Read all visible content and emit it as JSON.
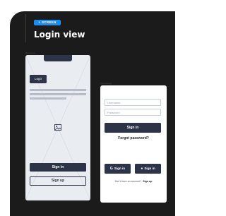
{
  "header": {
    "tag_label": "+ SCREEN",
    "title": "Login view"
  },
  "labels": {
    "wireframe": "Wireframe",
    "final": "Final design"
  },
  "wireframe": {
    "logo_label": "Logo",
    "signin_label": "Sign in",
    "signup_label": "Sign up"
  },
  "design": {
    "username_placeholder": "Username",
    "password_placeholder": "Password",
    "signin_label": "Sign in",
    "forgot_label": "Forgot password?",
    "social_signin_label_1": "Sign in",
    "social_signin_label_2": "Sign in",
    "no_account_text": "Don't have an account?",
    "signup_link": "Sign up"
  },
  "colors": {
    "background": "#1b1b1b",
    "accent": "#1b8cf0",
    "button": "#2d3448",
    "wireframe_bg": "#e9ecf1"
  },
  "icons": {
    "image_placeholder": "image-icon",
    "social_1": "google-icon",
    "social_2": "apple-icon"
  }
}
